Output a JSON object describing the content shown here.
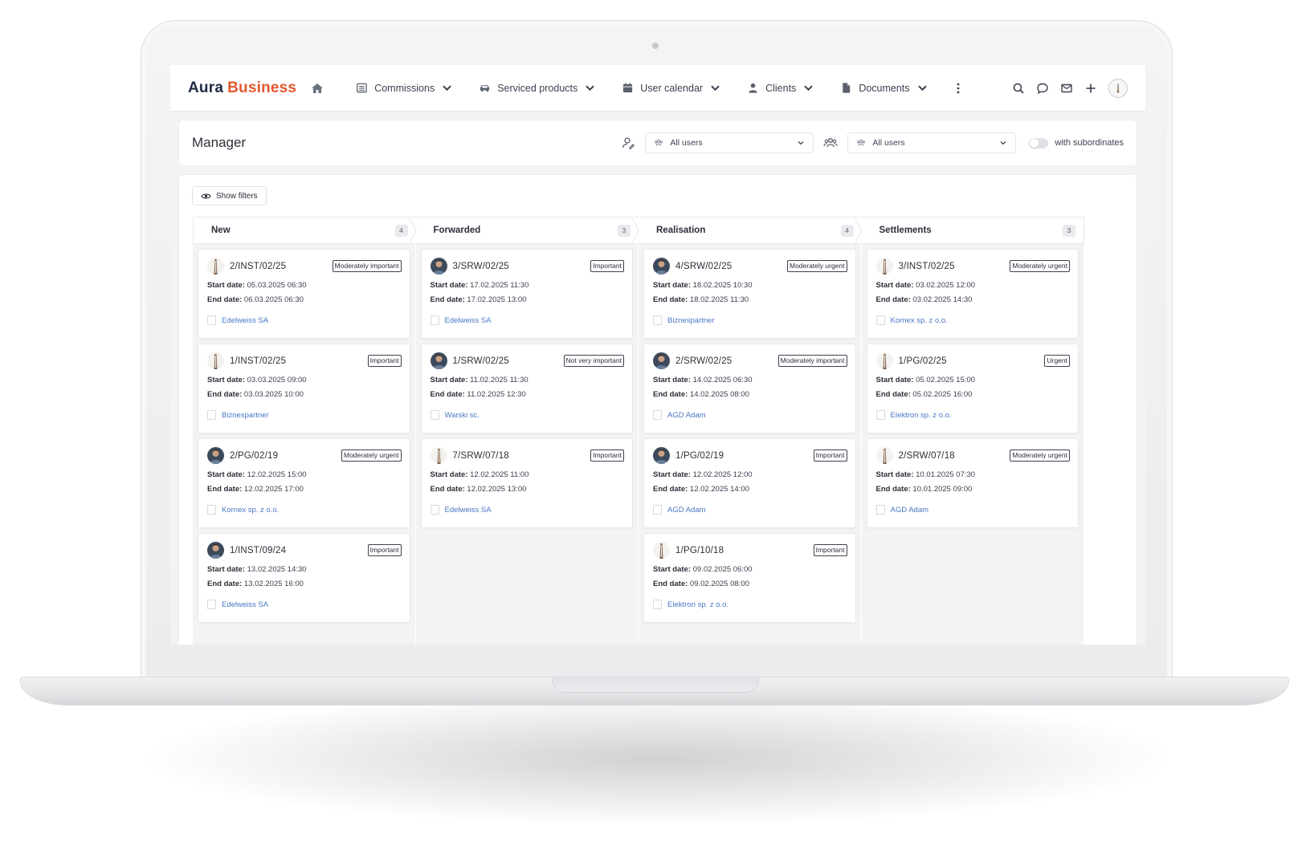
{
  "brand": {
    "name_part1": "Aura",
    "name_part2": "Business"
  },
  "nav": [
    {
      "label": "Commissions",
      "icon": "list-icon"
    },
    {
      "label": "Serviced products",
      "icon": "car-icon"
    },
    {
      "label": "User calendar",
      "icon": "calendar-icon"
    },
    {
      "label": "Clients",
      "icon": "user-icon"
    },
    {
      "label": "Documents",
      "icon": "document-icon"
    }
  ],
  "header": {
    "title": "Manager",
    "filter1": "All users",
    "filter2": "All users",
    "toggle_label": "with subordinates"
  },
  "board": {
    "show_filters": "Show filters",
    "columns": [
      {
        "title": "New",
        "count": "4",
        "cards": [
          {
            "id": "2/INST/02/25",
            "badge": "Moderately important",
            "start": "05.03.2025 06:30",
            "end": "06.03.2025 06:30",
            "client": "Edelweiss SA",
            "avatar": "light"
          },
          {
            "id": "1/INST/02/25",
            "badge": "Important",
            "start": "03.03.2025 09:00",
            "end": "03.03.2025 10:00",
            "client": "Biznespartner",
            "avatar": "light"
          },
          {
            "id": "2/PG/02/19",
            "badge": "Moderately urgent",
            "start": "12.02.2025 15:00",
            "end": "12.02.2025 17:00",
            "client": "Kornex sp. z o.o.",
            "avatar": "dark"
          },
          {
            "id": "1/INST/09/24",
            "badge": "Important",
            "start": "13.02.2025 14:30",
            "end": "13.02.2025 16:00",
            "client": "Edelweiss SA",
            "avatar": "dark"
          }
        ]
      },
      {
        "title": "Forwarded",
        "count": "3",
        "cards": [
          {
            "id": "3/SRW/02/25",
            "badge": "Important",
            "start": "17.02.2025 11:30",
            "end": "17.02.2025 13:00",
            "client": "Edelweiss SA",
            "avatar": "dark"
          },
          {
            "id": "1/SRW/02/25",
            "badge": "Not very important",
            "start": "11.02.2025 11:30",
            "end": "11.02.2025 12:30",
            "client": "Warski sc.",
            "avatar": "dark"
          },
          {
            "id": "7/SRW/07/18",
            "badge": "Important",
            "start": "12.02.2025 11:00",
            "end": "12.02.2025 13:00",
            "client": "Edelweiss SA",
            "avatar": "light"
          }
        ]
      },
      {
        "title": "Realisation",
        "count": "4",
        "cards": [
          {
            "id": "4/SRW/02/25",
            "badge": "Moderately urgent",
            "start": "18.02.2025 10:30",
            "end": "18.02.2025 11:30",
            "client": "Biznespartner",
            "avatar": "dark"
          },
          {
            "id": "2/SRW/02/25",
            "badge": "Moderately important",
            "start": "14.02.2025 06:30",
            "end": "14.02.2025 08:00",
            "client": "AGD Adam",
            "avatar": "dark"
          },
          {
            "id": "1/PG/02/19",
            "badge": "Important",
            "start": "12.02.2025 12:00",
            "end": "12.02.2025 14:00",
            "client": "AGD Adam",
            "avatar": "dark"
          },
          {
            "id": "1/PG/10/18",
            "badge": "Important",
            "start": "09.02.2025 06:00",
            "end": "09.02.2025 08:00",
            "client": "Elektron sp. z o.o.",
            "avatar": "light"
          }
        ]
      },
      {
        "title": "Settlements",
        "count": "3",
        "cards": [
          {
            "id": "3/INST/02/25",
            "badge": "Moderately urgent",
            "start": "03.02.2025 12:00",
            "end": "03.02.2025 14:30",
            "client": "Kornex sp. z o.o.",
            "avatar": "light"
          },
          {
            "id": "1/PG/02/25",
            "badge": "Urgent",
            "start": "05.02.2025 15:00",
            "end": "05.02.2025 16:00",
            "client": "Elektron sp. z o.o.",
            "avatar": "light"
          },
          {
            "id": "2/SRW/07/18",
            "badge": "Moderately urgent",
            "start": "10.01.2025 07:30",
            "end": "10.01.2025 09:00",
            "client": "AGD Adam",
            "avatar": "light"
          }
        ]
      }
    ],
    "start_label": "Start date:",
    "end_label": "End date:"
  },
  "colors": {
    "brand_dark": "#1f2a44",
    "brand_accent": "#e4572e",
    "link": "#4a76c5"
  }
}
